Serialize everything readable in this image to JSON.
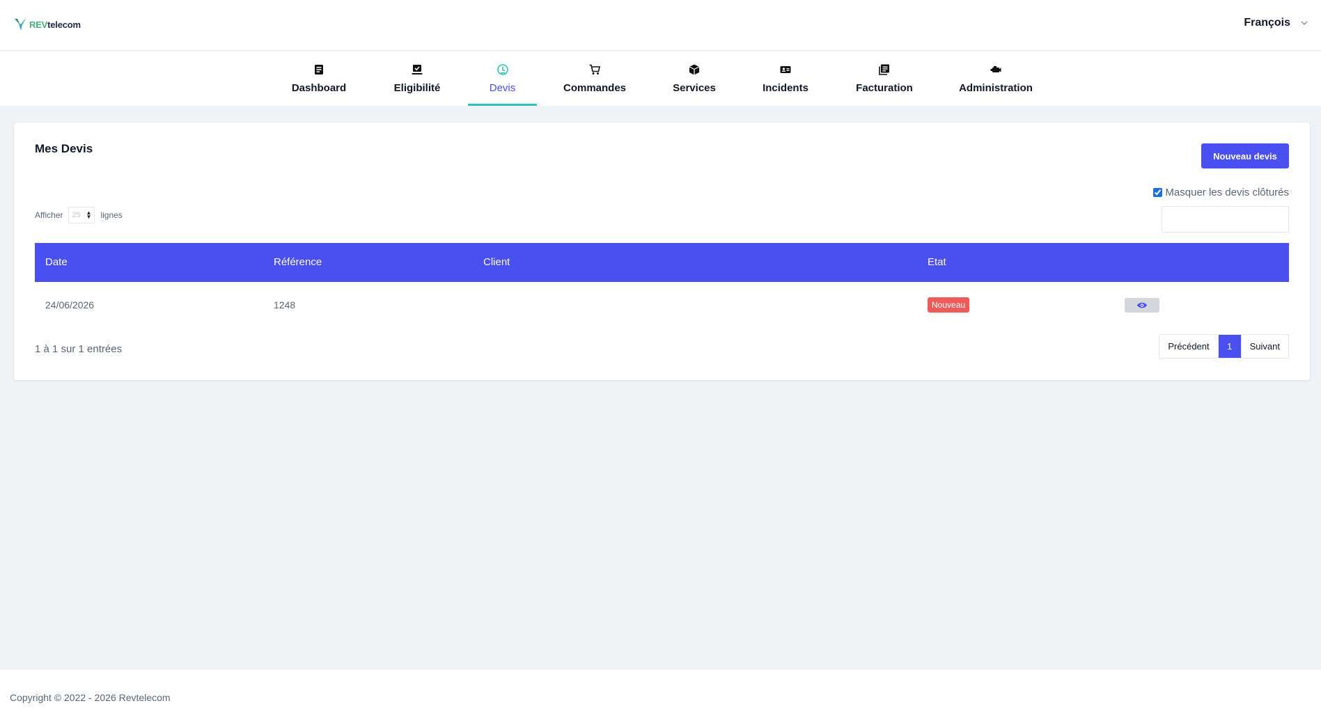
{
  "header": {
    "logo_prefix": "REV",
    "logo_suffix": "telecom",
    "user_name": "François"
  },
  "nav": {
    "items": [
      {
        "label": "Dashboard",
        "icon": "dashboard-icon"
      },
      {
        "label": "Eligibilité",
        "icon": "eligibility-icon"
      },
      {
        "label": "Devis",
        "icon": "quote-icon",
        "active": true
      },
      {
        "label": "Commandes",
        "icon": "cart-icon"
      },
      {
        "label": "Services",
        "icon": "box-icon"
      },
      {
        "label": "Incidents",
        "icon": "ticket-icon"
      },
      {
        "label": "Facturation",
        "icon": "invoice-icon"
      },
      {
        "label": "Administration",
        "icon": "admin-icon"
      }
    ]
  },
  "page": {
    "title": "Mes Devis",
    "new_button": "Nouveau devis",
    "hide_closed_label": "Masquer les devis clôturés",
    "hide_closed_checked": true,
    "search_value": "",
    "length_prefix": "Afficher",
    "length_value": "25",
    "length_suffix": "lignes"
  },
  "table": {
    "columns": [
      "Date",
      "Référence",
      "Client",
      "Etat"
    ],
    "rows": [
      {
        "date": "24/06/2026",
        "reference": "1248",
        "client": "",
        "status": "Nouveau"
      }
    ],
    "info": "1 à 1 sur 1 entrées"
  },
  "pagination": {
    "prev": "Précédent",
    "current": "1",
    "next": "Suivant"
  },
  "footer": {
    "copyright": "Copyright © 2022 - 2026 Revtelecom"
  },
  "colors": {
    "accent": "#4a4ff0",
    "active_tab_underline": "#2ec4b6",
    "status_new": "#ee5b5b"
  }
}
